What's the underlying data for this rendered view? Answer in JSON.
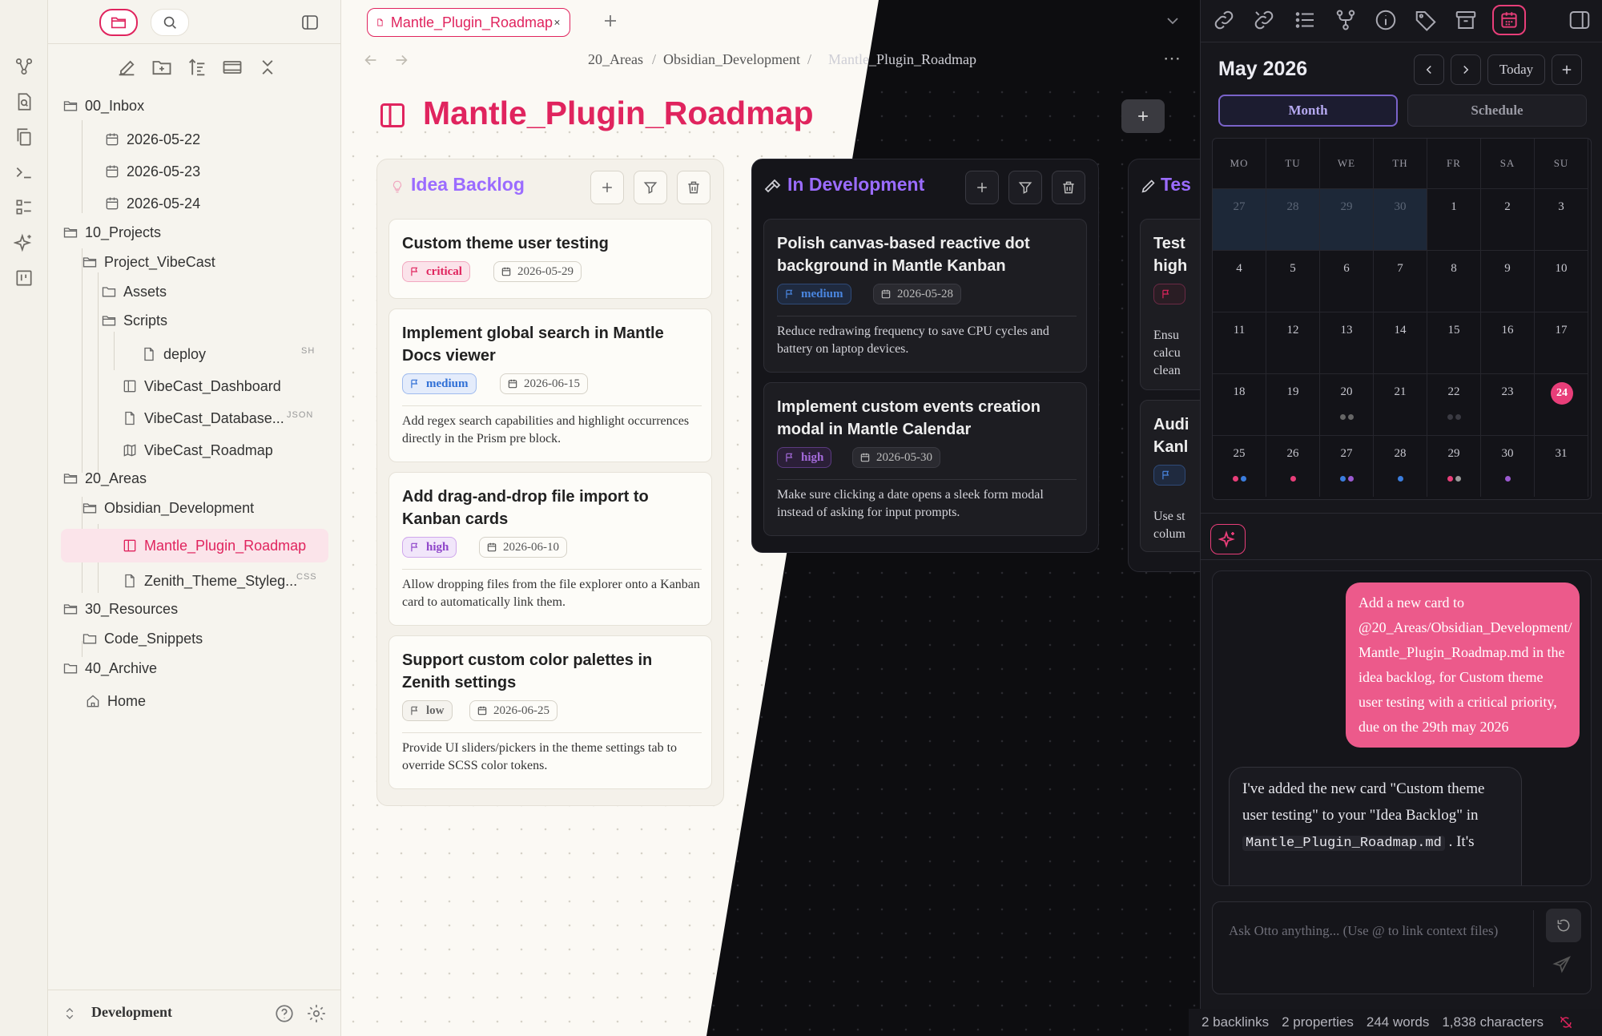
{
  "sidebar": {
    "tree": {
      "inbox": "00_Inbox",
      "d1": "2026-05-22",
      "d2": "2026-05-23",
      "d3": "2026-05-24",
      "projects": "10_Projects",
      "vibecast": "Project_VibeCast",
      "assets": "Assets",
      "scripts": "Scripts",
      "deploy": "deploy",
      "deploy_badge": "SH",
      "dashboard": "VibeCast_Dashboard",
      "database": "VibeCast_Database...",
      "database_badge": "JSON",
      "roadmap": "VibeCast_Roadmap",
      "areas": "20_Areas",
      "obsidian": "Obsidian_Development",
      "mantle": "Mantle_Plugin_Roadmap",
      "zenith": "Zenith_Theme_Styleg...",
      "zenith_badge": "CSS",
      "resources": "30_Resources",
      "snippets": "Code_Snippets",
      "archive": "40_Archive",
      "home": "Home"
    },
    "vault_name": "Development"
  },
  "tab": {
    "title": "Mantle_Plugin_Roadmap"
  },
  "breadcrumb": [
    "20_Areas",
    "Obsidian_Development",
    "Mantle_Plugin_Roadmap"
  ],
  "breadcrumb_sep": "/",
  "note": {
    "title": "Mantle_Plugin_Roadmap"
  },
  "kanban": {
    "columns": [
      {
        "title": "Idea Backlog",
        "cards": [
          {
            "title": "Custom theme user testing",
            "priority": "critical",
            "date": "2026-05-29",
            "desc": ""
          },
          {
            "title": "Implement global search in Mantle Docs viewer",
            "priority": "medium",
            "date": "2026-06-15",
            "desc": "Add regex search capabilities and highlight occurrences directly in the Prism pre block."
          },
          {
            "title": "Add drag-and-drop file import to Kanban cards",
            "priority": "high",
            "date": "2026-06-10",
            "desc": "Allow dropping files from the file explorer onto a Kanban card to automatically link them."
          },
          {
            "title": "Support custom color palettes in Zenith settings",
            "priority": "low",
            "date": "2026-06-25",
            "desc": "Provide UI sliders/pickers in the theme settings tab to override SCSS color tokens."
          }
        ]
      },
      {
        "title": "In Development",
        "cards": [
          {
            "title": "Polish canvas-based reactive dot background in Mantle Kanban",
            "priority": "medium",
            "date": "2026-05-28",
            "desc": "Reduce redrawing frequency to save CPU cycles and battery on laptop devices."
          },
          {
            "title": "Implement custom events creation modal in Mantle Calendar",
            "priority": "high",
            "date": "2026-05-30",
            "desc": "Make sure clicking a date opens a sleek form modal instead of asking for input prompts."
          }
        ]
      },
      {
        "title": "Tes",
        "cards": [
          {
            "title": "Test\nhigh",
            "desc": "Ensu\ncalcu\nclean"
          },
          {
            "title": "Audi\nKanl",
            "desc": "Use st\ncolum"
          }
        ]
      }
    ]
  },
  "calendar": {
    "month_label": "May 2026",
    "today_button": "Today",
    "view_month": "Month",
    "view_schedule": "Schedule",
    "weekdays": [
      "MO",
      "TU",
      "WE",
      "TH",
      "FR",
      "SA",
      "SU"
    ],
    "days": [
      "27",
      "28",
      "29",
      "30",
      "1",
      "2",
      "3",
      "4",
      "5",
      "6",
      "7",
      "8",
      "9",
      "10",
      "11",
      "12",
      "13",
      "14",
      "15",
      "16",
      "17",
      "18",
      "19",
      "20",
      "21",
      "22",
      "23",
      "24",
      "25",
      "26",
      "27",
      "28",
      "29",
      "30",
      "31"
    ],
    "today": "24"
  },
  "chat": {
    "user_message": "Add a new card to @20_Areas/Obsidian_Development/ Mantle_Plugin_Roadmap.md in the idea backlog, for Custom theme user testing with a critical priority, due on the 29th may 2026",
    "assistant_pre": "I've added the new card \"Custom theme user testing\" to your \"Idea Backlog\" in",
    "assistant_code": "Mantle_Plugin_Roadmap.md",
    "assistant_post": ". It's",
    "input_placeholder": "Ask Otto anything... (Use @ to link context files)"
  },
  "status": {
    "backlinks": "2 backlinks",
    "properties": "2 properties",
    "words": "244 words",
    "characters": "1,838 characters"
  },
  "colors": {
    "accent": "#e0245e",
    "backlog": "#9b6cff",
    "critical": "#e0245e",
    "medium": "#2f6fd6",
    "high": "#8e44c9",
    "low": "#777777",
    "today": "#e83e79"
  }
}
